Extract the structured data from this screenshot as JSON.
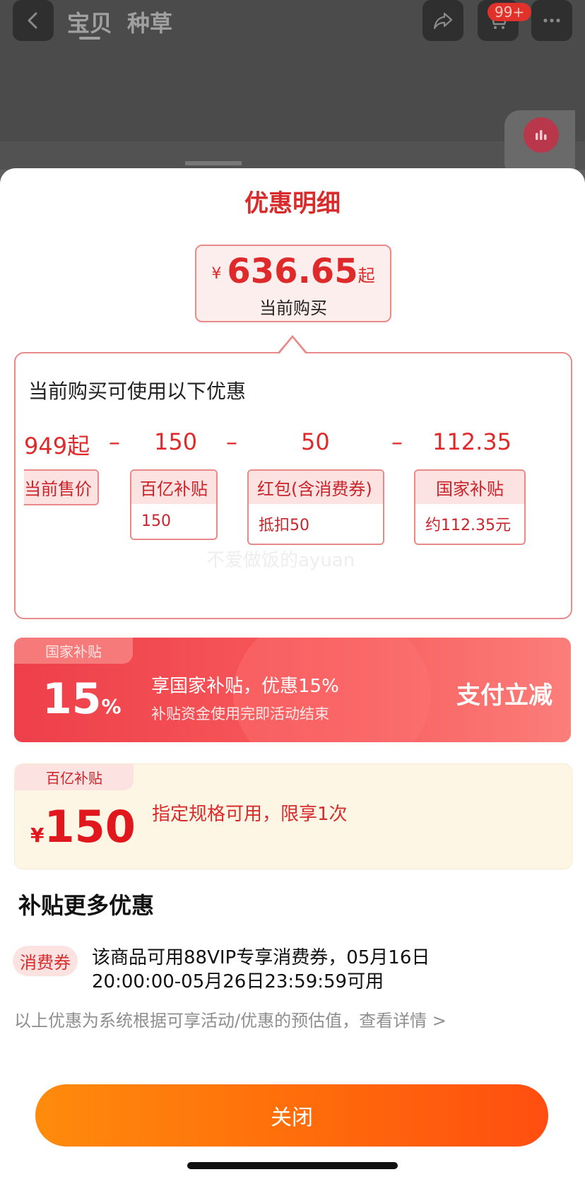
{
  "header": {
    "tabs": [
      "宝贝",
      "种草"
    ],
    "cart_badge": "99+"
  },
  "sheet": {
    "title": "优惠明细",
    "price": {
      "currency": "¥",
      "amount": "636.65",
      "suffix": "起",
      "caption": "当前购买"
    },
    "card": {
      "title": "当前购买可使用以下优惠",
      "amounts": [
        "949起",
        "150",
        "50",
        "112.35"
      ],
      "minus": "–",
      "tags": [
        {
          "head": "当前售价",
          "body": ""
        },
        {
          "head": "百亿补贴",
          "body": "150"
        },
        {
          "head": "红包(含消费券)",
          "body": "抵扣50"
        },
        {
          "head": "国家补贴",
          "body": "约112.35元"
        }
      ],
      "watermark": "不爱做饭的ayuan"
    },
    "promo_national": {
      "tab": "国家补贴",
      "percent": "15",
      "percent_sign": "%",
      "line1": "享国家补贴，优惠15%",
      "line2": "补贴资金使用完即活动结束",
      "cta": "支付立减"
    },
    "promo_billion": {
      "tab": "百亿补贴",
      "currency": "¥",
      "amount": "150",
      "desc": "指定规格可用，限享1次"
    },
    "more": {
      "title": "补贴更多优惠",
      "coupon_badge": "消费券",
      "coupon_text": "该商品可用88VIP专享消费券，05月16日20:00:00-05月26日23:59:59可用",
      "note": "以上优惠为系统根据可享活动/优惠的预估值，查看详情 >"
    },
    "close_label": "关闭"
  },
  "colors": {
    "accent_red": "#de2a2a",
    "close_orange": "#ff6b0b",
    "promo_yellow_bg": "#fef6e5"
  }
}
